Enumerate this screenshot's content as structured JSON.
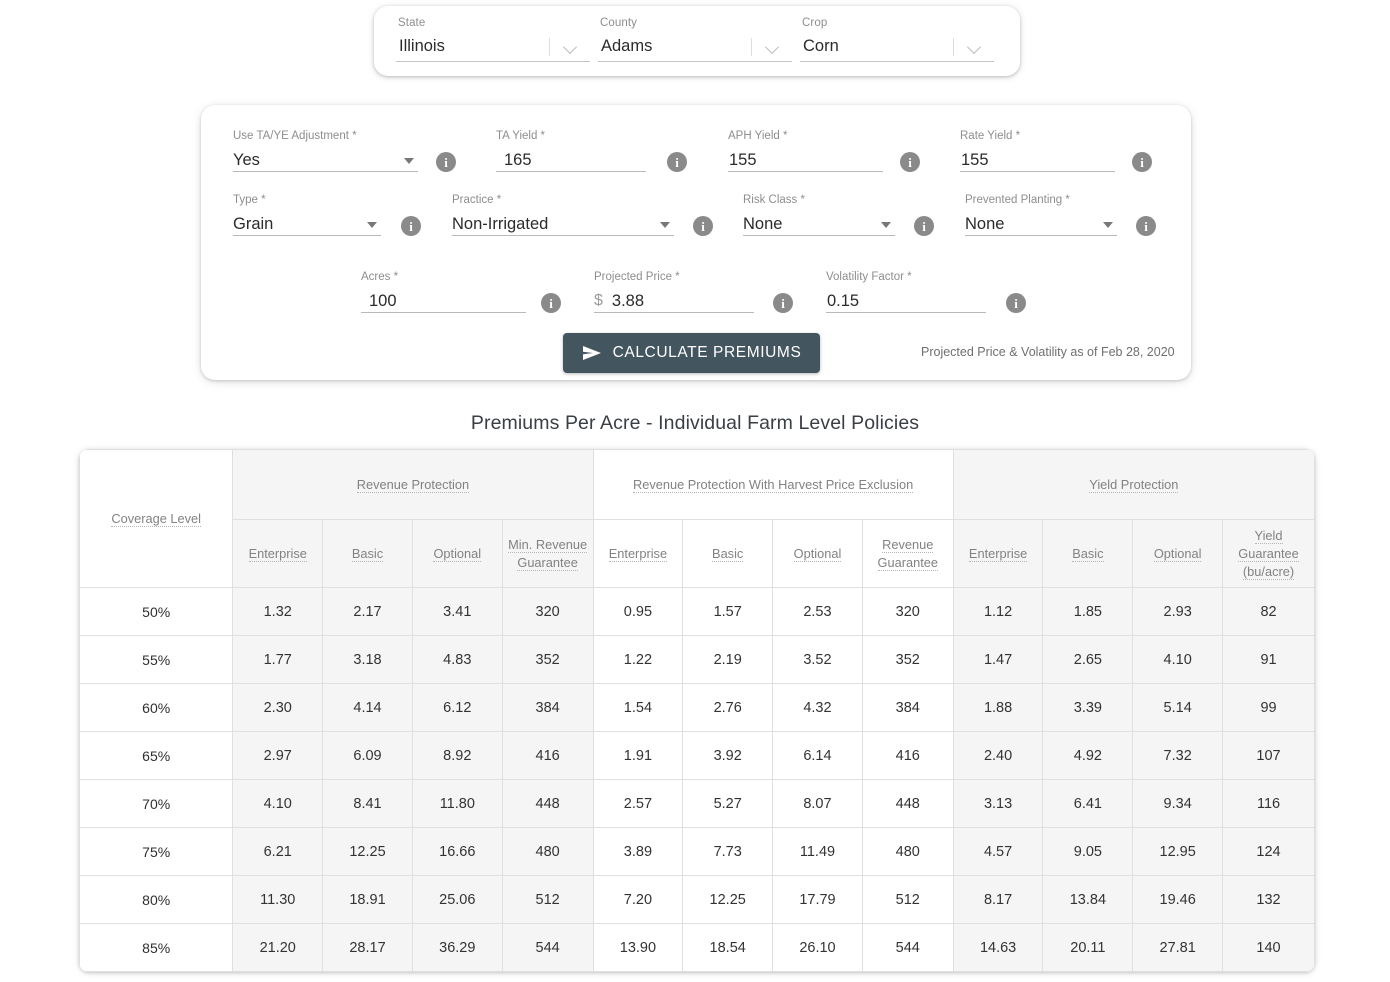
{
  "selectors": [
    {
      "label": "State",
      "value": "Illinois",
      "icon": "chevron-down-icon"
    },
    {
      "label": "County",
      "value": "Adams",
      "icon": "chevron-down-icon"
    },
    {
      "label": "Crop",
      "value": "Corn",
      "icon": "chevron-down-icon"
    }
  ],
  "form": {
    "fields": [
      {
        "name": "use-ta-ye-adjustment",
        "label": "Use TA/YE Adjustment *",
        "value": "Yes",
        "type": "select",
        "info": "info-icon"
      },
      {
        "name": "ta-yield",
        "label": "TA Yield *",
        "value": "165",
        "type": "text",
        "info": "info-icon"
      },
      {
        "name": "aph-yield",
        "label": "APH Yield *",
        "value": "155",
        "type": "text",
        "info": "info-icon"
      },
      {
        "name": "rate-yield",
        "label": "Rate Yield *",
        "value": "155",
        "type": "text",
        "info": "info-icon"
      },
      {
        "name": "type",
        "label": "Type *",
        "value": "Grain",
        "type": "select",
        "info": "info-icon"
      },
      {
        "name": "practice",
        "label": "Practice *",
        "value": "Non-Irrigated",
        "type": "select",
        "info": "info-icon"
      },
      {
        "name": "risk-class",
        "label": "Risk Class *",
        "value": "None",
        "type": "select",
        "info": "info-icon"
      },
      {
        "name": "prevented-planting",
        "label": "Prevented Planting *",
        "value": "None",
        "type": "select",
        "info": "info-icon"
      },
      {
        "name": "acres",
        "label": "Acres *",
        "value": "100",
        "type": "text",
        "info": "info-icon"
      },
      {
        "name": "projected-price",
        "label": "Projected Price *",
        "value": "3.88",
        "prefix": "$",
        "type": "text",
        "info": "info-icon"
      },
      {
        "name": "volatility-factor",
        "label": "Volatility Factor *",
        "value": "0.15",
        "type": "text",
        "info": "info-icon"
      }
    ],
    "calculate_button": {
      "label": "CALCULATE PREMIUMS",
      "icon": "send-arrow-icon",
      "color": "#43555f"
    },
    "as_of_note": "Projected Price & Volatility as of Feb 28, 2020"
  },
  "table": {
    "title": "Premiums Per Acre - Individual Farm Level Policies",
    "row_header": "Coverage Level",
    "groups": [
      {
        "label": "Revenue Protection",
        "columns": [
          "Enterprise",
          "Basic",
          "Optional",
          "Min. Revenue Guarantee"
        ],
        "shaded": true
      },
      {
        "label": "Revenue Protection With Harvest Price Exclusion",
        "columns": [
          "Enterprise",
          "Basic",
          "Optional",
          "Revenue Guarantee"
        ],
        "shaded": false
      },
      {
        "label": "Yield Protection",
        "columns": [
          "Enterprise",
          "Basic",
          "Optional",
          "Yield Guarantee (bu/acre)"
        ],
        "shaded": true
      }
    ],
    "rows": [
      {
        "coverage": "50%",
        "values": [
          "1.32",
          "2.17",
          "3.41",
          "320",
          "0.95",
          "1.57",
          "2.53",
          "320",
          "1.12",
          "1.85",
          "2.93",
          "82"
        ]
      },
      {
        "coverage": "55%",
        "values": [
          "1.77",
          "3.18",
          "4.83",
          "352",
          "1.22",
          "2.19",
          "3.52",
          "352",
          "1.47",
          "2.65",
          "4.10",
          "91"
        ]
      },
      {
        "coverage": "60%",
        "values": [
          "2.30",
          "4.14",
          "6.12",
          "384",
          "1.54",
          "2.76",
          "4.32",
          "384",
          "1.88",
          "3.39",
          "5.14",
          "99"
        ]
      },
      {
        "coverage": "65%",
        "values": [
          "2.97",
          "6.09",
          "8.92",
          "416",
          "1.91",
          "3.92",
          "6.14",
          "416",
          "2.40",
          "4.92",
          "7.32",
          "107"
        ]
      },
      {
        "coverage": "70%",
        "values": [
          "4.10",
          "8.41",
          "11.80",
          "448",
          "2.57",
          "5.27",
          "8.07",
          "448",
          "3.13",
          "6.41",
          "9.34",
          "116"
        ]
      },
      {
        "coverage": "75%",
        "values": [
          "6.21",
          "12.25",
          "16.66",
          "480",
          "3.89",
          "7.73",
          "11.49",
          "480",
          "4.57",
          "9.05",
          "12.95",
          "124"
        ]
      },
      {
        "coverage": "80%",
        "values": [
          "11.30",
          "18.91",
          "25.06",
          "512",
          "7.20",
          "12.25",
          "17.79",
          "512",
          "8.17",
          "13.84",
          "19.46",
          "132"
        ]
      },
      {
        "coverage": "85%",
        "values": [
          "21.20",
          "28.17",
          "36.29",
          "544",
          "13.90",
          "18.54",
          "26.10",
          "544",
          "14.63",
          "20.11",
          "27.81",
          "140"
        ]
      }
    ]
  }
}
